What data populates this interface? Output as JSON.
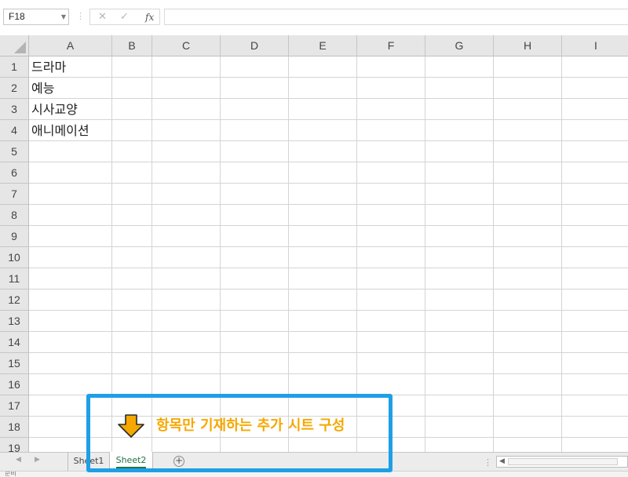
{
  "formula_bar": {
    "name_box": "F18",
    "cancel_icon": "✕",
    "enter_icon": "✓",
    "function_icon": "fx",
    "formula_value": ""
  },
  "columns": [
    "A",
    "B",
    "C",
    "D",
    "E",
    "F",
    "G",
    "H",
    "I"
  ],
  "rows": [
    "1",
    "2",
    "3",
    "4",
    "5",
    "6",
    "7",
    "8",
    "9",
    "10",
    "11",
    "12",
    "13",
    "14",
    "15",
    "16",
    "17",
    "18",
    "19"
  ],
  "cells": {
    "A1": "드라마",
    "A2": "예능",
    "A3": "시사교양",
    "A4": "애니메이션"
  },
  "sheet_tabs": {
    "sheet1": "Sheet1",
    "sheet2": "Sheet2",
    "active": "Sheet2",
    "add_icon": "+"
  },
  "callout": {
    "text": "항목만 기재하는 추가 시트 구성",
    "border_color": "#1e9fe6",
    "text_color": "#f5a800",
    "arrow_color": "#f5a800",
    "arrow_icon": "down-arrow-icon"
  },
  "status_bar": {
    "text": "준비"
  },
  "colors": {
    "accent": "#217346",
    "header_bg": "#e6e6e6",
    "gridline": "#d4d4d4"
  }
}
